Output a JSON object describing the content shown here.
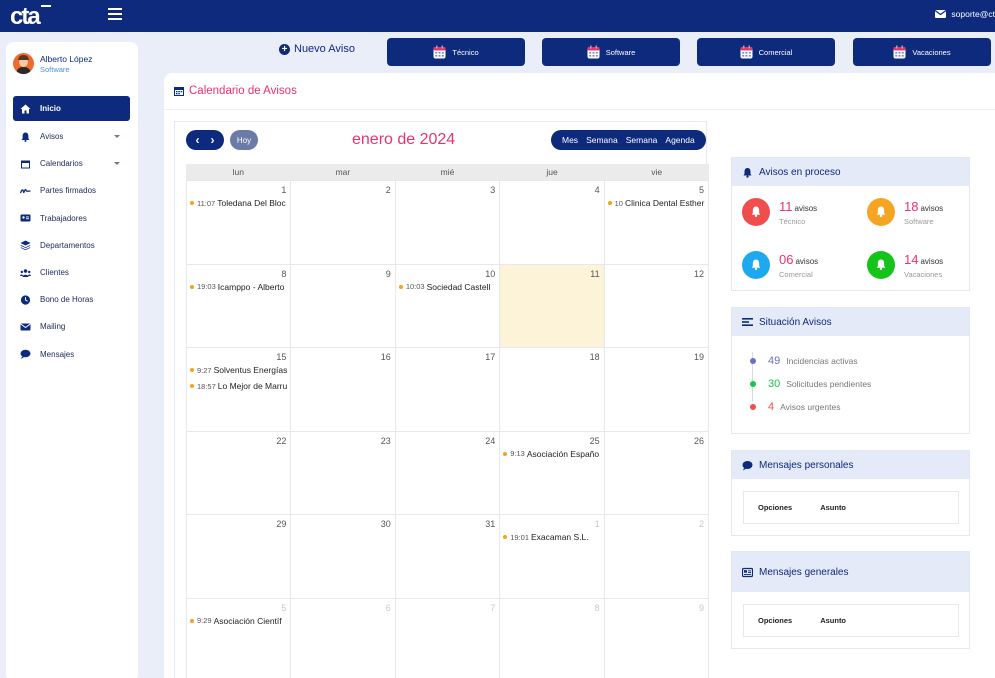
{
  "header": {
    "support_email": "soporte@ct",
    "logo_alt": "CTA"
  },
  "profile": {
    "name": "Alberto López",
    "role": "Software"
  },
  "nav": [
    {
      "label": "Inicio",
      "icon": "home-icon",
      "active": true
    },
    {
      "label": "Avisos",
      "icon": "bell-icon",
      "caret": true
    },
    {
      "label": "Calendarios",
      "icon": "calendar-icon",
      "caret": true
    },
    {
      "label": "Partes firmados",
      "icon": "signature-icon"
    },
    {
      "label": "Trabajadores",
      "icon": "id-card-icon"
    },
    {
      "label": "Departamentos",
      "icon": "layers-icon"
    },
    {
      "label": "Clientes",
      "icon": "users-icon"
    },
    {
      "label": "Bono de Horas",
      "icon": "clock-icon"
    },
    {
      "label": "Mailing",
      "icon": "envelope-icon"
    },
    {
      "label": "Mensajes",
      "icon": "chat-icon"
    }
  ],
  "actions": {
    "new_notice": "Nuevo Aviso",
    "categories": [
      "Técnico",
      "Software",
      "Comercial",
      "Vacaciones"
    ]
  },
  "main": {
    "title": "Calendario de Avisos"
  },
  "calendar": {
    "title": "enero de 2024",
    "today_label": "Hoy",
    "views": [
      "Mes",
      "Semana",
      "Semana",
      "Agenda"
    ],
    "weekdays": [
      "lun",
      "mar",
      "mié",
      "jue",
      "vie"
    ],
    "weeks": [
      [
        {
          "d": "1",
          "events": [
            {
              "time": "11:07",
              "text": "Toledana Del Bloc"
            }
          ]
        },
        {
          "d": "2"
        },
        {
          "d": "3"
        },
        {
          "d": "4"
        },
        {
          "d": "5",
          "events": [
            {
              "time": "10",
              "text": "Clinica Dental Esther"
            }
          ]
        }
      ],
      [
        {
          "d": "8",
          "events": [
            {
              "time": "19:03",
              "text": "Icamppo - Alberto"
            }
          ]
        },
        {
          "d": "9"
        },
        {
          "d": "10",
          "events": [
            {
              "time": "10:03",
              "text": "Sociedad Castell"
            }
          ]
        },
        {
          "d": "11",
          "today": true
        },
        {
          "d": "12"
        }
      ],
      [
        {
          "d": "15",
          "events": [
            {
              "time": "9:27",
              "text": "Solventus Energías"
            },
            {
              "time": "18:57",
              "text": "Lo Mejor de Marru"
            }
          ]
        },
        {
          "d": "16"
        },
        {
          "d": "17"
        },
        {
          "d": "18"
        },
        {
          "d": "19"
        }
      ],
      [
        {
          "d": "22"
        },
        {
          "d": "23"
        },
        {
          "d": "24"
        },
        {
          "d": "25",
          "events": [
            {
              "time": "9:13",
              "text": "Asociación Españo"
            }
          ]
        },
        {
          "d": "26"
        }
      ],
      [
        {
          "d": "29"
        },
        {
          "d": "30"
        },
        {
          "d": "31"
        },
        {
          "d": "1",
          "other": true,
          "events": [
            {
              "time": "19:01",
              "text": "Exacaman S.L."
            }
          ]
        },
        {
          "d": "2",
          "other": true
        }
      ],
      [
        {
          "d": "5",
          "other": true,
          "events": [
            {
              "time": "9:29",
              "text": "Asociación Científ"
            }
          ]
        },
        {
          "d": "6",
          "other": true
        },
        {
          "d": "7",
          "other": true
        },
        {
          "d": "8",
          "other": true
        },
        {
          "d": "9",
          "other": true
        }
      ]
    ]
  },
  "avisos_panel": {
    "title": "Avisos en proceso",
    "unit": "avisos",
    "stats": [
      {
        "num": "11",
        "label": "Técnico",
        "color": "#f04d4d"
      },
      {
        "num": "18",
        "label": "Software",
        "color": "#f6a523"
      },
      {
        "num": "06",
        "label": "Comercial",
        "color": "#1da9f0"
      },
      {
        "num": "14",
        "label": "Vacaciones",
        "color": "#14c41a"
      }
    ]
  },
  "situacion_panel": {
    "title": "Situación Avisos",
    "rows": [
      {
        "num": "49",
        "label": "Incidencias activas",
        "color": "#6b6fc0"
      },
      {
        "num": "30",
        "label": "Solicitudes pendientes",
        "color": "#1bc44a"
      },
      {
        "num": "4",
        "label": "Avisos urgentes",
        "color": "#f04d4d"
      }
    ]
  },
  "mensajes_personales": {
    "title": "Mensajes personales",
    "col1": "Opciones",
    "col2": "Asunto"
  },
  "mensajes_generales": {
    "title": "Mensajes generales",
    "col1": "Opciones",
    "col2": "Asunto"
  },
  "colors": {
    "primary": "#0d2a7c",
    "accent": "#e8336d",
    "event_dot": "#f4a11c",
    "today_bg": "#fdf3d9"
  }
}
